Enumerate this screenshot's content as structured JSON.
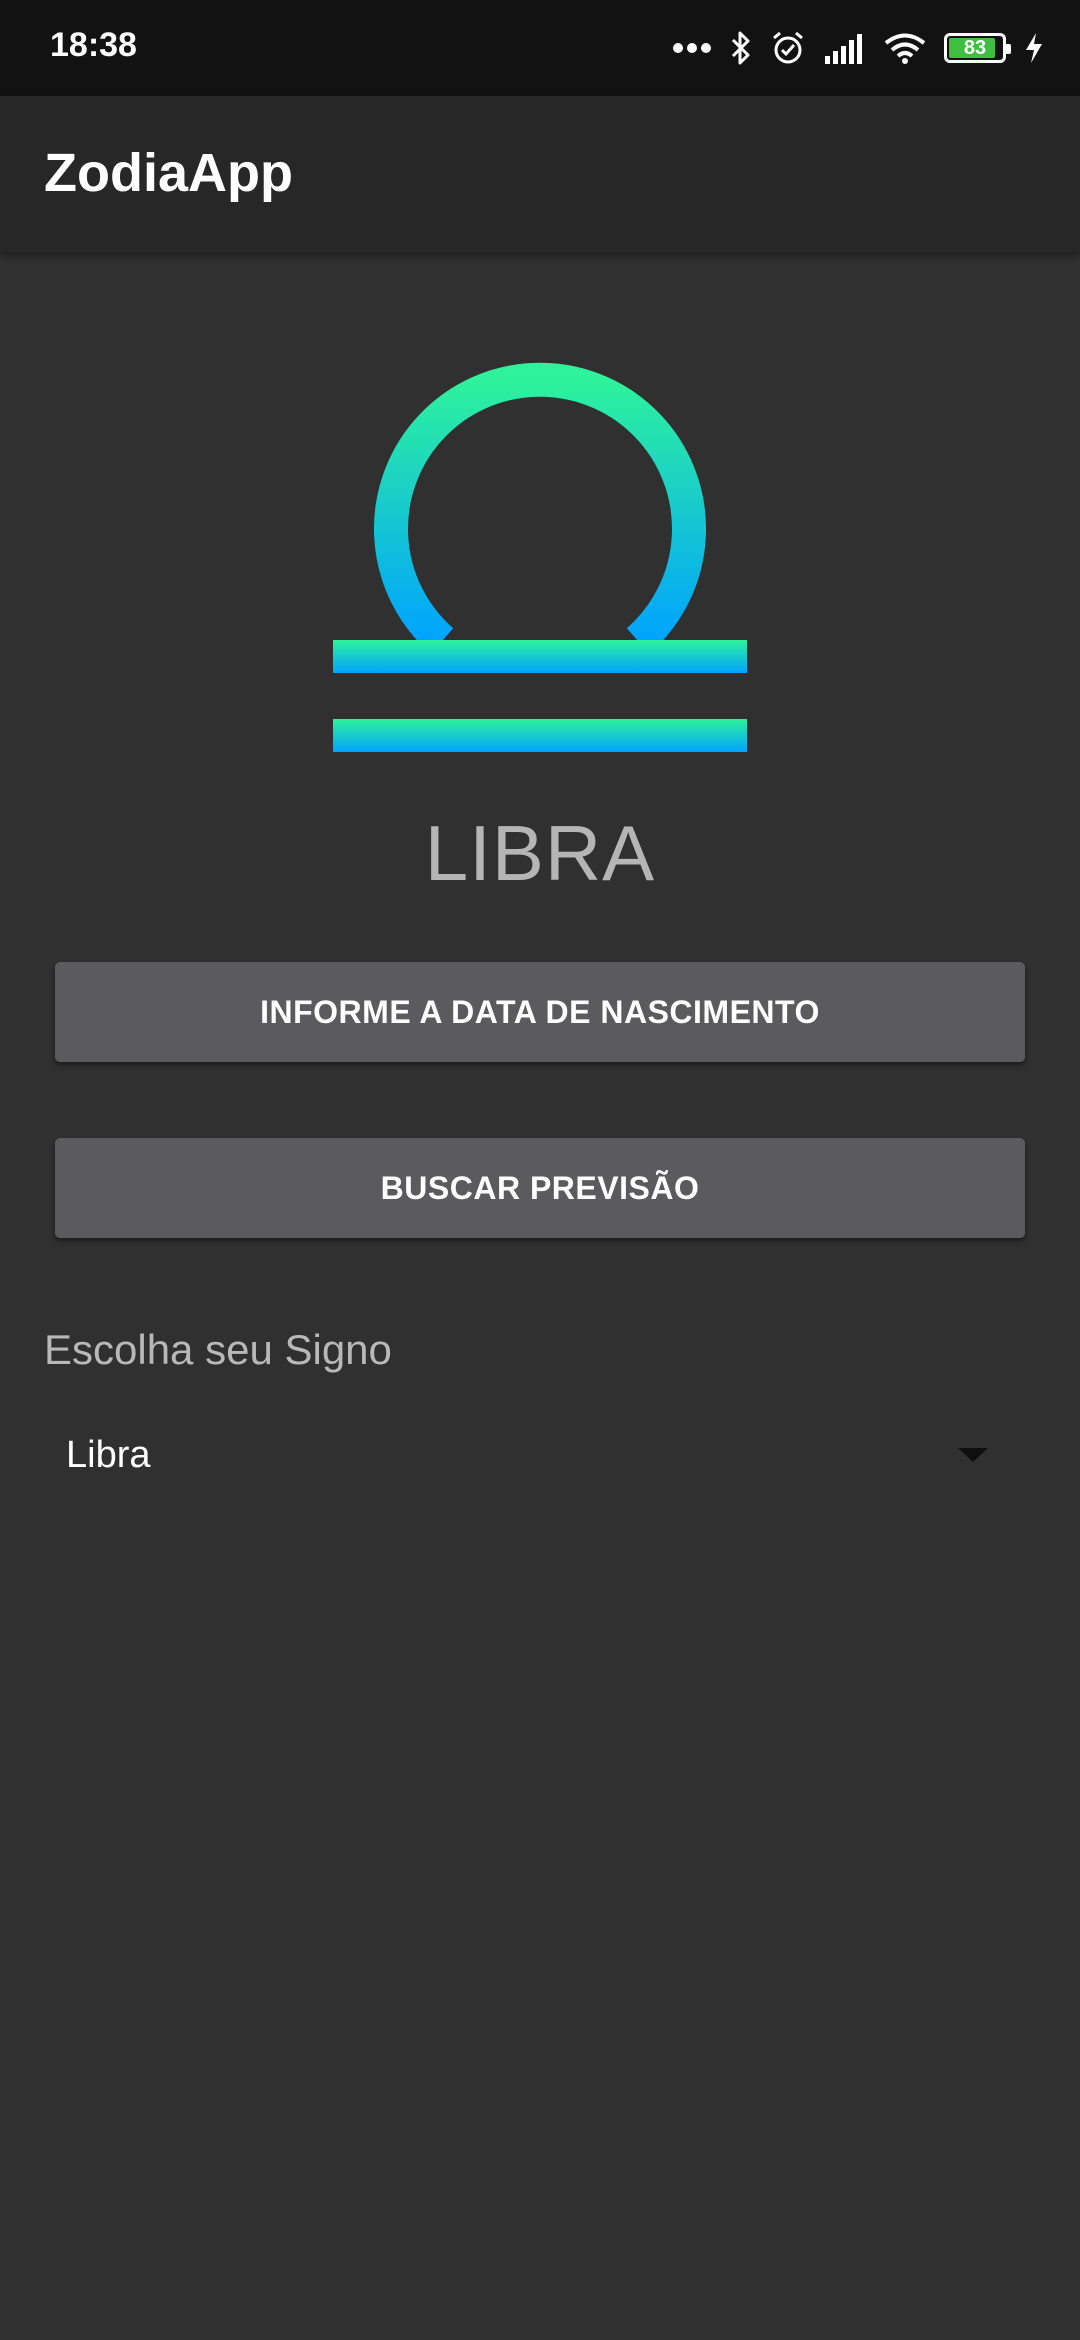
{
  "status_bar": {
    "time": "18:38",
    "battery_level": "83",
    "icons": [
      "more-dots-icon",
      "bluetooth-icon",
      "alarm-icon",
      "signal-icon",
      "wifi-icon",
      "battery-icon",
      "charging-icon"
    ]
  },
  "app_bar": {
    "title": "ZodiaApp"
  },
  "sign": {
    "icon": "libra-icon",
    "name": "LIBRA",
    "gradient_top": "#2ef29c",
    "gradient_bottom": "#00a3ff"
  },
  "buttons": {
    "birth_date": "INFORME A DATA DE NASCIMENTO",
    "forecast": "BUSCAR PREVISÃO"
  },
  "sign_selector": {
    "label": "Escolha seu Signo",
    "selected": "Libra"
  },
  "colors": {
    "background": "#303030",
    "app_bar": "#272727",
    "status_bar": "#121212",
    "button": "#5b5b5d",
    "battery_fill": "#3fbf3f"
  }
}
